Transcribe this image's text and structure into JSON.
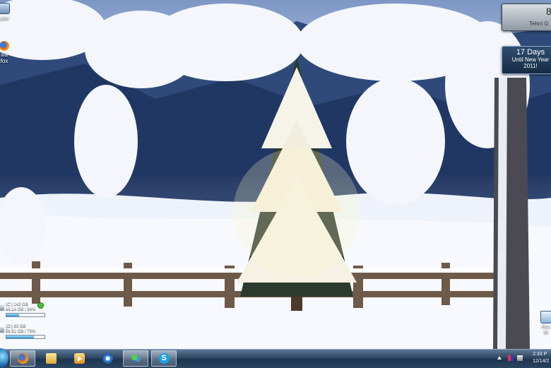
{
  "desktop": {
    "icons": [
      {
        "label": "uter"
      },
      {
        "label": "illa\nfox"
      }
    ],
    "recycle_bin": {
      "label": "Rec\nBi"
    }
  },
  "drive_gadget": {
    "drives": [
      {
        "line1": "(C:) 142 GB",
        "line2": "48.14 GB / 34%",
        "used_fraction": 0.34
      },
      {
        "line1": "(D:) 80 GB",
        "line2": "58.51 GB / 73%",
        "used_fraction": 0.73
      }
    ]
  },
  "clock_gadget": {
    "big": "8",
    "small": "Tehni G"
  },
  "countdown_gadget": {
    "days": "17 Days",
    "line1": "Until New Year",
    "line2": "2011!"
  },
  "taskbar": {
    "buttons": [
      {
        "name": "firefox",
        "active": true
      },
      {
        "name": "windows-explorer",
        "active": false
      },
      {
        "name": "media-player",
        "active": false
      },
      {
        "name": "itunes",
        "active": false
      },
      {
        "name": "messenger",
        "active": true
      },
      {
        "name": "skype",
        "active": true,
        "glyph": "S"
      }
    ],
    "clock": {
      "time": "2:33 P",
      "date": "12/14/2"
    }
  }
}
